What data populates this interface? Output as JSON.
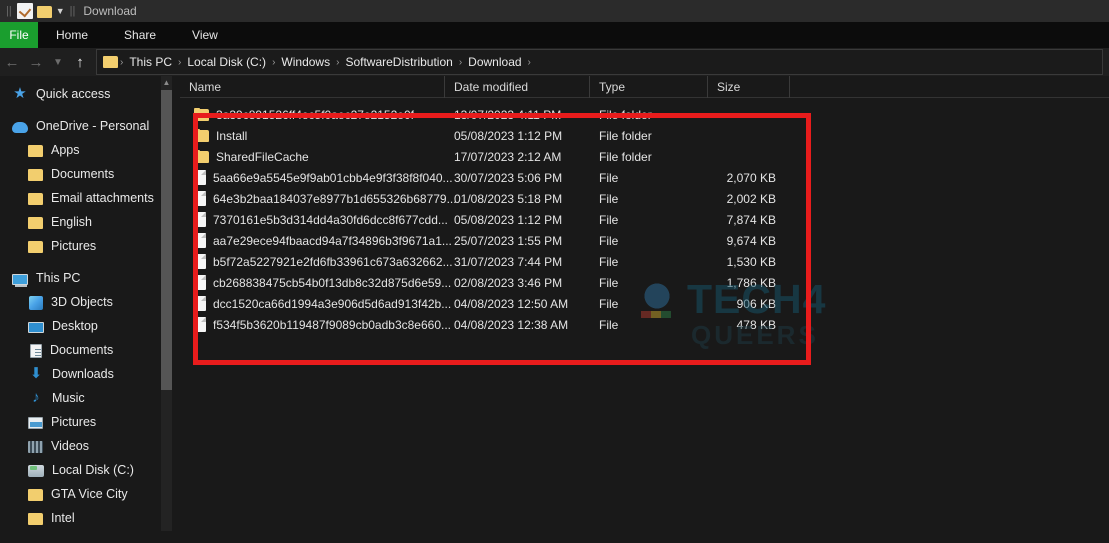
{
  "window": {
    "title": "Download",
    "quick_access_icons": [
      "properties-icon",
      "folder-icon",
      "chevron-down-icon"
    ]
  },
  "ribbon": {
    "file_label": "File",
    "tabs": [
      "Home",
      "Share",
      "View"
    ]
  },
  "nav": {
    "back_icon": "arrow-left-icon",
    "forward_icon": "arrow-right-icon",
    "history_icon": "chevron-down-icon",
    "up_icon": "arrow-up-icon",
    "breadcrumbs": [
      "This PC",
      "Local Disk (C:)",
      "Windows",
      "SoftwareDistribution",
      "Download"
    ],
    "separator": "›"
  },
  "sidebar": {
    "items": [
      {
        "label": "Quick access",
        "icon": "star-icon",
        "indent": false
      },
      {
        "label": "OneDrive - Personal",
        "icon": "cloud-icon",
        "indent": false
      },
      {
        "label": "Apps",
        "icon": "folder-icon",
        "indent": true
      },
      {
        "label": "Documents",
        "icon": "folder-icon",
        "indent": true
      },
      {
        "label": "Email attachments",
        "icon": "folder-icon",
        "indent": true
      },
      {
        "label": "English",
        "icon": "folder-icon",
        "indent": true
      },
      {
        "label": "Pictures",
        "icon": "folder-icon",
        "indent": true
      },
      {
        "label": "This PC",
        "icon": "computer-icon",
        "indent": false
      },
      {
        "label": "3D Objects",
        "icon": "cube-icon",
        "indent": true
      },
      {
        "label": "Desktop",
        "icon": "desktop-icon",
        "indent": true
      },
      {
        "label": "Documents",
        "icon": "document-icon",
        "indent": true
      },
      {
        "label": "Downloads",
        "icon": "download-arrow-icon",
        "indent": true
      },
      {
        "label": "Music",
        "icon": "music-note-icon",
        "indent": true
      },
      {
        "label": "Pictures",
        "icon": "picture-icon",
        "indent": true
      },
      {
        "label": "Videos",
        "icon": "video-icon",
        "indent": true
      },
      {
        "label": "Local Disk (C:)",
        "icon": "disk-icon",
        "indent": true
      },
      {
        "label": "GTA Vice City",
        "icon": "folder-icon",
        "indent": true,
        "extra": true
      },
      {
        "label": "Intel",
        "icon": "folder-icon",
        "indent": true,
        "extra": true
      }
    ]
  },
  "filelist": {
    "columns": [
      "Name",
      "Date modified",
      "Type",
      "Size"
    ],
    "sort_column": "Name",
    "sort_direction": "ascending",
    "rows": [
      {
        "name": "3a39c891526ff4ec5f0aec27e2152e0f",
        "date": "13/07/2023 4:11 PM",
        "type": "File folder",
        "size": "",
        "icon": "folder-icon"
      },
      {
        "name": "Install",
        "date": "05/08/2023 1:12 PM",
        "type": "File folder",
        "size": "",
        "icon": "folder-icon"
      },
      {
        "name": "SharedFileCache",
        "date": "17/07/2023 2:12 AM",
        "type": "File folder",
        "size": "",
        "icon": "folder-icon"
      },
      {
        "name": "5aa66e9a5545e9f9ab01cbb4e9f3f38f8f040...",
        "date": "30/07/2023 5:06 PM",
        "type": "File",
        "size": "2,070 KB",
        "icon": "file-icon"
      },
      {
        "name": "64e3b2baa184037e8977b1d655326b68779...",
        "date": "01/08/2023 5:18 PM",
        "type": "File",
        "size": "2,002 KB",
        "icon": "file-icon"
      },
      {
        "name": "7370161e5b3d314dd4a30fd6dcc8f677cdd...",
        "date": "05/08/2023 1:12 PM",
        "type": "File",
        "size": "7,874 KB",
        "icon": "file-icon"
      },
      {
        "name": "aa7e29ece94fbaacd94a7f34896b3f9671a1...",
        "date": "25/07/2023 1:55 PM",
        "type": "File",
        "size": "9,674 KB",
        "icon": "file-icon"
      },
      {
        "name": "b5f72a5227921e2fd6fb33961c673a632662...",
        "date": "31/07/2023 7:44 PM",
        "type": "File",
        "size": "1,530 KB",
        "icon": "file-icon"
      },
      {
        "name": "cb268838475cb54b0f13db8c32d875d6e59...",
        "date": "02/08/2023 3:46 PM",
        "type": "File",
        "size": "1,786 KB",
        "icon": "file-icon"
      },
      {
        "name": "dcc1520ca66d1994a3e906d5d6ad913f42b...",
        "date": "04/08/2023 12:50 AM",
        "type": "File",
        "size": "906 KB",
        "icon": "file-icon"
      },
      {
        "name": "f534f5b3620b119487f9089cb0adb3c8e660...",
        "date": "04/08/2023 12:38 AM",
        "type": "File",
        "size": "478 KB",
        "icon": "file-icon"
      }
    ]
  },
  "annotation": {
    "color": "#e81c1c"
  },
  "watermark": {
    "text": "TECH4",
    "subtext": "QUEERS"
  }
}
